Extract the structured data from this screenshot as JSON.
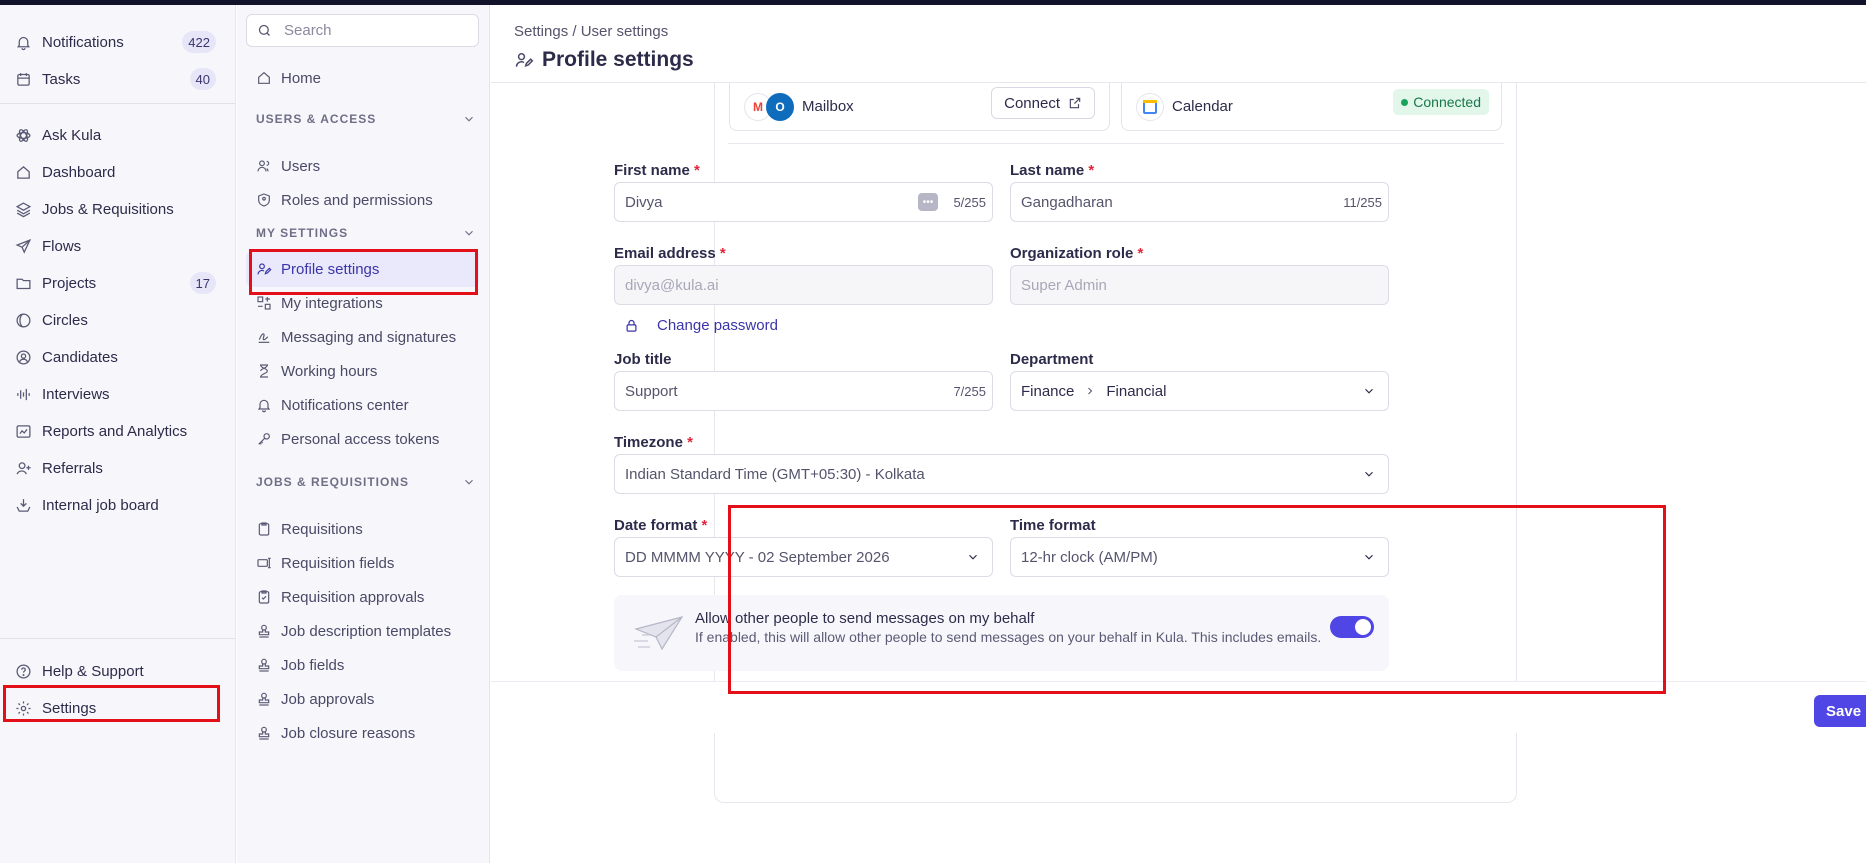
{
  "leftnav": {
    "items": [
      {
        "label": "Notifications",
        "badge": "422"
      },
      {
        "label": "Tasks",
        "badge": "40"
      },
      {
        "label": "Ask Kula"
      },
      {
        "label": "Dashboard"
      },
      {
        "label": "Jobs & Requisitions"
      },
      {
        "label": "Flows"
      },
      {
        "label": "Projects",
        "badge": "17"
      },
      {
        "label": "Circles"
      },
      {
        "label": "Candidates"
      },
      {
        "label": "Interviews"
      },
      {
        "label": "Reports and Analytics"
      },
      {
        "label": "Referrals"
      },
      {
        "label": "Internal job board"
      }
    ],
    "bottom": [
      {
        "label": "Help & Support"
      },
      {
        "label": "Settings"
      }
    ]
  },
  "settings_nav": {
    "search_placeholder": "Search",
    "home": "Home",
    "users_access": {
      "heading": "USERS & ACCESS",
      "items": [
        "Users",
        "Roles and permissions"
      ]
    },
    "my_settings": {
      "heading": "MY SETTINGS",
      "items": [
        "Profile settings",
        "My integrations",
        "Messaging and signatures",
        "Working hours",
        "Notifications center",
        "Personal access tokens"
      ]
    },
    "jobs_requisitions": {
      "heading": "JOBS & REQUISITIONS",
      "items": [
        "Requisitions",
        "Requisition fields",
        "Requisition approvals",
        "Job description templates",
        "Job fields",
        "Job approvals",
        "Job closure reasons"
      ]
    }
  },
  "header": {
    "breadcrumb": "Settings / User settings",
    "title": "Profile settings"
  },
  "integrations": {
    "mailbox": {
      "name": "Mailbox",
      "action": "Connect"
    },
    "calendar": {
      "name": "Calendar",
      "status": "Connected"
    }
  },
  "form": {
    "first_name": {
      "label": "First name",
      "value": "Divya",
      "count": "5/255"
    },
    "last_name": {
      "label": "Last name",
      "value": "Gangadharan",
      "count": "11/255"
    },
    "email": {
      "label": "Email address",
      "placeholder": "divya@kula.ai"
    },
    "org_role": {
      "label": "Organization role",
      "placeholder": "Super Admin"
    },
    "change_password": "Change password",
    "job_title": {
      "label": "Job title",
      "value": "Support",
      "count": "7/255"
    },
    "department": {
      "label": "Department",
      "parent": "Finance",
      "child": "Financial"
    },
    "timezone": {
      "label": "Timezone",
      "value": "Indian Standard Time (GMT+05:30) - Kolkata"
    },
    "date_format": {
      "label": "Date format",
      "value": "DD MMMM YYYY - 02 September 2026"
    },
    "time_format": {
      "label": "Time format",
      "value": "12-hr clock (AM/PM)"
    },
    "required_mark": "*"
  },
  "behalf": {
    "title": "Allow other people to send messages on my behalf",
    "description": "If enabled, this will allow other people to send messages on your behalf in Kula. This includes emails.",
    "enabled": true
  },
  "footer": {
    "save": "Save"
  },
  "colors": {
    "accent": "#4f46e5",
    "highlight": "#e3101a",
    "connected_bg": "#e3f6ea"
  }
}
